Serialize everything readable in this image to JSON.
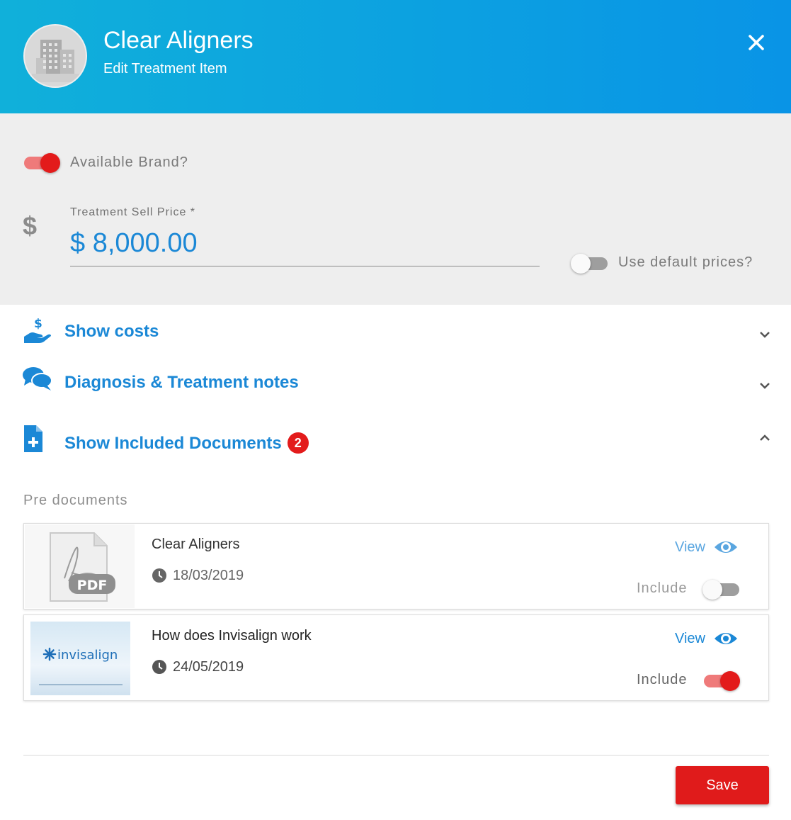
{
  "header": {
    "title": "Clear Aligners",
    "subtitle": "Edit Treatment Item",
    "avatar_icon": "building-icon",
    "close_icon": "close-icon"
  },
  "form": {
    "available_brand_label": "Available Brand?",
    "available_brand_on": true,
    "price_label": "Treatment Sell Price *",
    "price_value": "$ 8,000.00",
    "currency_icon": "$",
    "use_default_label": "Use default prices?",
    "use_default_on": false
  },
  "sections": [
    {
      "label": "Show costs",
      "icon": "hand-dollar-icon",
      "expanded": false
    },
    {
      "label": "Diagnosis & Treatment notes",
      "icon": "chat-bubbles-icon",
      "expanded": false
    },
    {
      "label": "Show Included Documents",
      "icon": "document-plus-icon",
      "expanded": true,
      "badge": "2"
    }
  ],
  "pre_documents_label": "Pre documents",
  "documents": [
    {
      "title": "Clear Aligners",
      "date": "18/03/2019",
      "view_label": "View",
      "include_label": "Include",
      "included": false,
      "thumb_type": "pdf",
      "thumb_text": "PDF"
    },
    {
      "title": "How does Invisalign work",
      "date": "24/05/2019",
      "view_label": "View",
      "include_label": "Include",
      "included": true,
      "thumb_type": "invisalign",
      "thumb_text": "invisalign"
    }
  ],
  "colors": {
    "accent": "#1b88d6",
    "danger": "#e31b1b",
    "header_start": "#10b0da",
    "header_end": "#0994e6"
  },
  "save_label": "Save"
}
